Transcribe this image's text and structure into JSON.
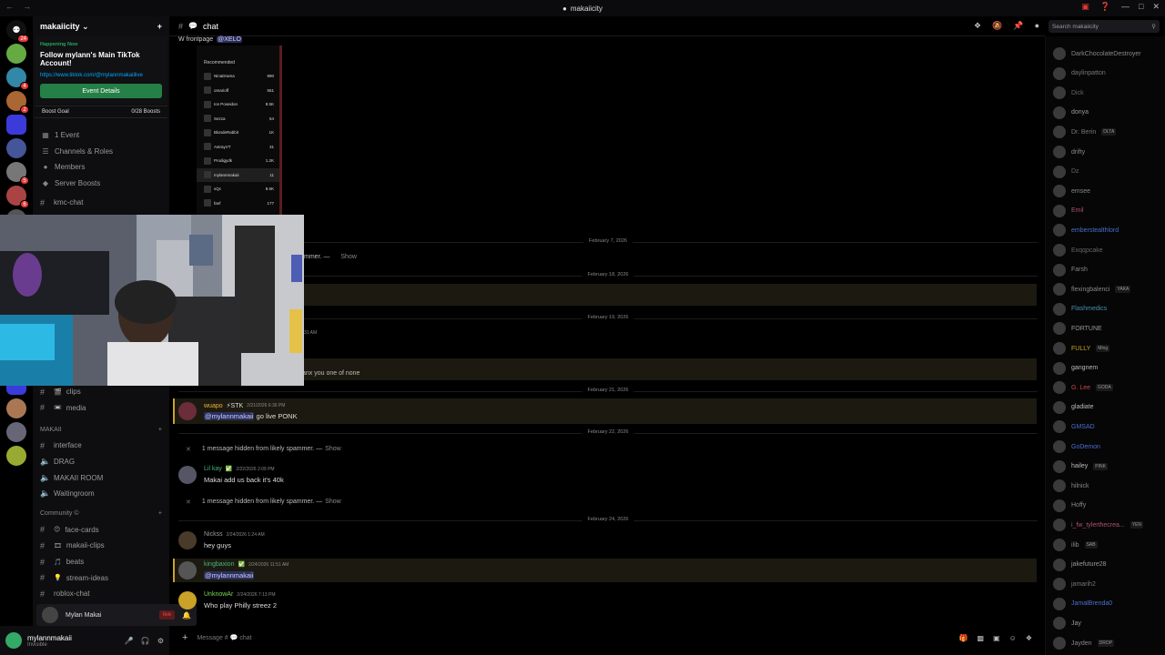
{
  "window": {
    "title": "makaiicity"
  },
  "server": {
    "name": "makaiicity"
  },
  "event": {
    "happening_label": "Happening Now",
    "title": "Follow mylann's Main TikTok Account!",
    "link": "https://www.tiktok.com/@mylannmakaiilive",
    "button_label": "Event Details"
  },
  "boost": {
    "label": "Boost Goal",
    "progress": "0/28 Boosts"
  },
  "sidebar_items": [
    {
      "icon": "calendar-icon",
      "label": "1 Event"
    },
    {
      "icon": "list-icon",
      "label": "Channels & Roles"
    },
    {
      "icon": "members-icon",
      "label": "Members"
    },
    {
      "icon": "boost-icon",
      "label": "Server Boosts"
    }
  ],
  "channels_top": [
    {
      "label": "kmc-chat"
    }
  ],
  "channels_upper": [
    {
      "emoji": "🎬",
      "label": "clips"
    },
    {
      "emoji": "📼",
      "label": "media"
    }
  ],
  "category_makaii": {
    "label": "MAKAII"
  },
  "channels_makaii": [
    {
      "type": "text",
      "label": "interface"
    },
    {
      "type": "voice",
      "label": "DRAG"
    },
    {
      "type": "voice",
      "label": "MAKAII ROOM"
    },
    {
      "type": "voice",
      "label": "Waitingroom"
    }
  ],
  "category_community": {
    "label": "Community ©"
  },
  "channels_community": [
    {
      "emoji": "😊",
      "label": "face-cards"
    },
    {
      "emoji": "🎞",
      "label": "makaii-clips"
    },
    {
      "emoji": "🎵",
      "label": "beats"
    },
    {
      "emoji": "💡",
      "label": "stream-ideas"
    },
    {
      "emoji": "",
      "label": "roblox-chat"
    }
  ],
  "voice_popup": {
    "name": "Mylan Makai",
    "live": "live"
  },
  "user": {
    "name": "mylannmakaii",
    "status": "Invisible"
  },
  "chat_header": {
    "channel": "chat"
  },
  "search": {
    "placeholder": "Search makaiicity"
  },
  "embed": {
    "heading": "W frontpage",
    "mention": "@XELO",
    "recommended_label": "Recommended",
    "rows": [
      {
        "name": "NinaDrama",
        "count": "890"
      },
      {
        "name": "omarioff",
        "count": "551"
      },
      {
        "name": "Ice Poseidon",
        "count": "8.5K"
      },
      {
        "name": "Sezza",
        "count": "54"
      },
      {
        "name": "BlondeRabbit",
        "count": "1K"
      },
      {
        "name": "AstrayVT",
        "count": "31"
      },
      {
        "name": "Prodigydk",
        "count": "1.2K"
      },
      {
        "name": "mylannmakaii",
        "count": "11"
      },
      {
        "name": "xQc",
        "count": "8.6K"
      },
      {
        "name": "fanf",
        "count": "177"
      }
    ]
  },
  "dates": {
    "d1": "February 7, 2026",
    "d2": "February 18, 2026",
    "d3": "February 19, 2026",
    "d4": "February 21, 2026",
    "d5": "February 22, 2026",
    "d6": "February 24, 2026"
  },
  "hidden": {
    "partial": "mmer. —",
    "text": "1 message hidden from likely spammer. —",
    "show": "Show"
  },
  "partial_msg": {
    "time": "31 AM",
    "body": "anx you one of none"
  },
  "messages": [
    {
      "name": "wuapo",
      "tag": "⚡STK",
      "time": "2/21/2026 6:36 PM",
      "mention": "@mylannmakaii",
      "body": " go live PONK",
      "color": "#f0b232"
    },
    {
      "name": "Lil kay",
      "tag": "✅",
      "time": "2/22/2026 2:09 PM",
      "mention": "",
      "body": "Makai add us back it's 40k",
      "color": "#43b581"
    },
    {
      "name": "Nickss",
      "tag": "",
      "time": "2/24/2026 1:24 AM",
      "mention": "",
      "body": "hey guys",
      "color": "#9a9a9a"
    },
    {
      "name": "kingbaxion",
      "tag": "✅",
      "time": "2/24/2026 11:51 AM",
      "mention": "@mylannmakaii",
      "body": "",
      "color": "#43b581"
    },
    {
      "name": "UnknowAr",
      "tag": "",
      "time": "2/24/2026 7:13 PM",
      "mention": "",
      "body": "Who play Philly streez 2",
      "color": "#7ed957"
    }
  ],
  "composer": {
    "placeholder": "Message #",
    "channel": "chat"
  },
  "members": [
    {
      "name": "DarkChocolateDestroyer",
      "tag": ""
    },
    {
      "name": "daylinpatton",
      "tag": ""
    },
    {
      "name": "Dick",
      "tag": ""
    },
    {
      "name": "donya",
      "tag": ""
    },
    {
      "name": "Dr. Berin",
      "tag": "DLTA"
    },
    {
      "name": "drifty",
      "tag": ""
    },
    {
      "name": "Dz",
      "tag": ""
    },
    {
      "name": "emsee",
      "tag": ""
    },
    {
      "name": "Emil",
      "tag": ""
    },
    {
      "name": "emberstealthlord",
      "tag": ""
    },
    {
      "name": "Exqqpcake",
      "tag": ""
    },
    {
      "name": "Farsh",
      "tag": ""
    },
    {
      "name": "flexingbalenci",
      "tag": "YAKA"
    },
    {
      "name": "Flashmedics",
      "tag": ""
    },
    {
      "name": "FORTUNE",
      "tag": ""
    },
    {
      "name": "FULLY",
      "tag": "Ming"
    },
    {
      "name": "gangnem",
      "tag": ""
    },
    {
      "name": "G. Lee",
      "tag": "GODA"
    },
    {
      "name": "gladiate",
      "tag": ""
    },
    {
      "name": "GMSAD",
      "tag": ""
    },
    {
      "name": "GoDemon",
      "tag": ""
    },
    {
      "name": "hailey",
      "tag": "PINK"
    },
    {
      "name": "hilnick",
      "tag": ""
    },
    {
      "name": "Hoffy",
      "tag": ""
    },
    {
      "name": "i_fw_tylerthecrea...",
      "tag": "YEN"
    },
    {
      "name": "ilib",
      "tag": "SAB"
    },
    {
      "name": "jakefuture28",
      "tag": ""
    },
    {
      "name": "jamarih2",
      "tag": ""
    },
    {
      "name": "JamalBrenda0",
      "tag": ""
    },
    {
      "name": "Jay",
      "tag": ""
    },
    {
      "name": "Jayden",
      "tag": "DROP"
    }
  ],
  "colors": {
    "accent_green": "#248046",
    "link_blue": "#00a8fc",
    "highlight_gold": "#c9a227"
  }
}
